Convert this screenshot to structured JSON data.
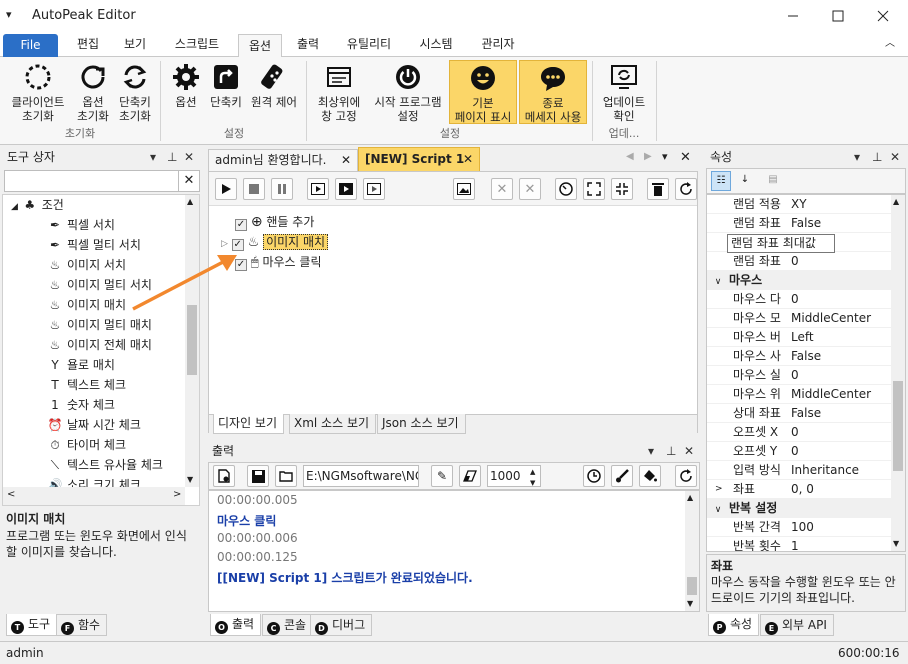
{
  "app": {
    "title": "AutoPeak Editor"
  },
  "menu": {
    "file": "File",
    "items": [
      "편집",
      "보기",
      "스크립트",
      "옵션",
      "출력",
      "유틸리티",
      "시스템",
      "관리자"
    ],
    "active": "옵션"
  },
  "ribbon": {
    "buttons": [
      {
        "label": "클라이언트\n초기화",
        "icon": "dashed-circle-icon"
      },
      {
        "label": "옵션\n초기화",
        "icon": "refresh-icon"
      },
      {
        "label": "단축키\n초기화",
        "icon": "refresh-double-icon"
      },
      {
        "label": "옵션",
        "icon": "gear-icon"
      },
      {
        "label": "단축키",
        "icon": "shortcut-icon"
      },
      {
        "label": "원격 제어",
        "icon": "remote-icon"
      },
      {
        "label": "최상위에\n창 고정",
        "icon": "window-pin-icon"
      },
      {
        "label": "시작 프로그램\n설정",
        "icon": "power-icon"
      },
      {
        "label": "기본\n페이지 표시",
        "icon": "smiley-icon"
      },
      {
        "label": "종료\n메세지 사용",
        "icon": "speech-icon"
      },
      {
        "label": "업데이트\n확인",
        "icon": "update-icon"
      }
    ],
    "groups": [
      "초기화",
      "설정",
      "설정",
      "업데..."
    ]
  },
  "toolbox": {
    "title": "도구 상자",
    "category": "조건",
    "items": [
      "픽셀 서치",
      "픽셀 멀티 서치",
      "이미지 서치",
      "이미지 멀티 서치",
      "이미지 매치",
      "이미지 멀티 매치",
      "이미지 전체 매치",
      "욜로 매치",
      "텍스트 체크",
      "숫자 체크",
      "날짜 시간 체크",
      "타이머 체크",
      "텍스트 유사율 체크",
      "소리 크기 체크"
    ],
    "desc_title": "이미지 매치",
    "desc_text": "프로그램 또는 윈도우 화면에서 인식할 이미지를 찾습니다.",
    "tabs": [
      "도구",
      "함수"
    ]
  },
  "editor": {
    "tabs": [
      "admin님 환영합니다.",
      "[NEW] Script 1"
    ],
    "nodes": [
      "핸들 추가",
      "이미지 매치",
      "마우스 클릭"
    ],
    "view_tabs": [
      "디자인 보기",
      "Xml 소스 보기",
      "Json 소스 보기"
    ]
  },
  "output": {
    "title": "출력",
    "path": "E:\\NGMsoftware\\NG",
    "count": "1000",
    "lines": [
      {
        "text": "00:00:00.005",
        "kind": "time"
      },
      {
        "text": "마우스 클릭",
        "kind": "msg"
      },
      {
        "text": "00:00:00.006",
        "kind": "time"
      },
      {
        "text": "00:00:00.125",
        "kind": "time"
      },
      {
        "text": "[[NEW] Script 1] 스크립트가 완료되었습니다.",
        "kind": "msg"
      }
    ],
    "tabs": [
      "출력",
      "콘솔",
      "디버그"
    ]
  },
  "props": {
    "title": "속성",
    "rows": [
      {
        "k": "랜덤 적용",
        "v": "XY"
      },
      {
        "k": "랜덤 좌표",
        "v": "False"
      },
      {
        "k": "랜덤 좌표 최대값",
        "v": "",
        "tooltip": true
      },
      {
        "k": "랜덤 좌표",
        "v": "0"
      },
      {
        "cat": "마우스"
      },
      {
        "k": "마우스 다",
        "v": "0"
      },
      {
        "k": "마우스 모",
        "v": "MiddleCenter"
      },
      {
        "k": "마우스 버",
        "v": "Left"
      },
      {
        "k": "마우스 사",
        "v": "False"
      },
      {
        "k": "마우스 실",
        "v": "0"
      },
      {
        "k": "마우스 위",
        "v": "MiddleCenter"
      },
      {
        "k": "상대 좌표",
        "v": "False"
      },
      {
        "k": "오프셋 X",
        "v": "0"
      },
      {
        "k": "오프셋 Y",
        "v": "0"
      },
      {
        "k": "입력 방식",
        "v": "Inheritance"
      },
      {
        "k": "좌표",
        "v": "0, 0",
        "exp": true
      },
      {
        "cat": "반복 설정"
      },
      {
        "k": "반복 간격",
        "v": "100"
      },
      {
        "k": "반복 횟수",
        "v": "1"
      }
    ],
    "desc_title": "좌표",
    "desc_text": "마우스 동작을 수행할 윈도우 또는 안드로이드 기기의 좌표입니다.",
    "tabs": [
      "속성",
      "외부 API"
    ]
  },
  "status": {
    "user": "admin",
    "time": "600:00:16"
  }
}
